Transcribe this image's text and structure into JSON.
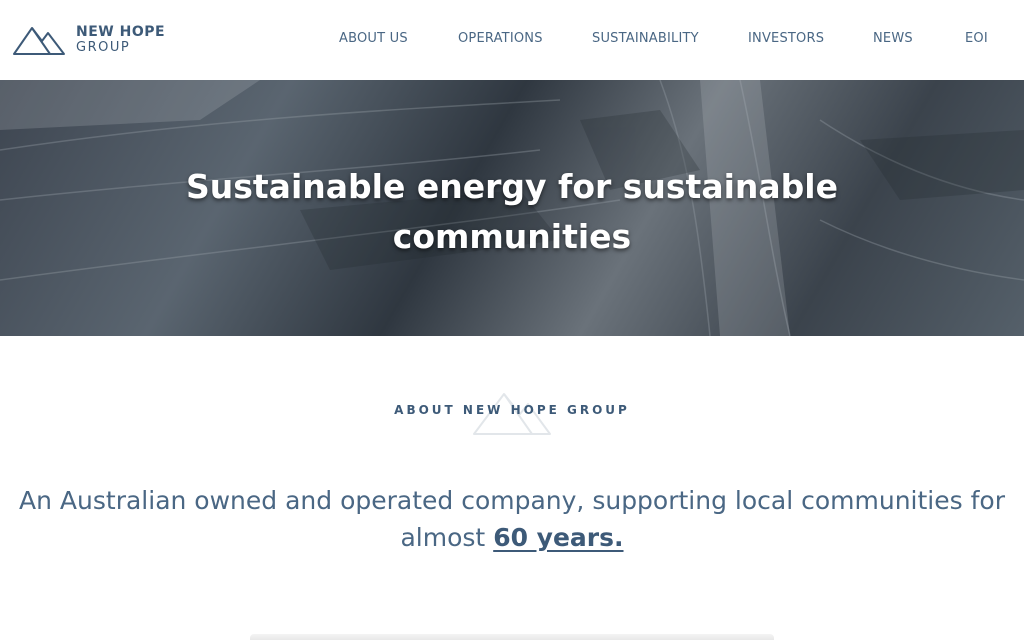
{
  "brand": {
    "name_line1": "NEW HOPE",
    "name_line2": "GROUP",
    "color": "#3d5a78"
  },
  "nav": {
    "items": [
      {
        "label": "ABOUT US"
      },
      {
        "label": "OPERATIONS"
      },
      {
        "label": "SUSTAINABILITY"
      },
      {
        "label": "INVESTORS"
      },
      {
        "label": "NEWS"
      },
      {
        "label": "EOI"
      }
    ]
  },
  "hero": {
    "title_line1": "Sustainable energy for sustainable",
    "title_line2": "communities"
  },
  "about": {
    "eyebrow": "ABOUT NEW HOPE GROUP",
    "lead_text": "An Australian owned and operated company, supporting local communities for almost ",
    "lead_emphasis": "60 years."
  }
}
